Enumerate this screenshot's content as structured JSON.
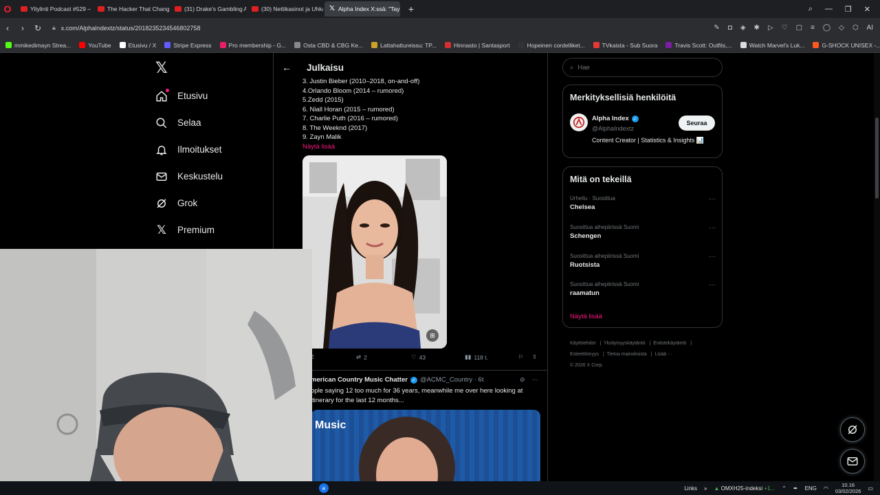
{
  "browser": {
    "tabs": [
      {
        "label": "Yliylinti Podcast #529 – U",
        "active": false
      },
      {
        "label": "The Hacker That Changed",
        "active": false
      },
      {
        "label": "(31) Drake's Gambling Ad",
        "active": false
      },
      {
        "label": "(30) Nettikasinot ja Uhkap",
        "active": false
      },
      {
        "label": "Alpha Index X:ssä: \"Taylor",
        "active": true
      }
    ],
    "url": "x.com/AlphaIndextz/status/2018235234546802758",
    "bookmarks": [
      {
        "label": "mmikedimayn Strea...",
        "color": "#53fc18"
      },
      {
        "label": "YouTube",
        "color": "#ff0000"
      },
      {
        "label": "Etusivu / X",
        "color": "#ffffff"
      },
      {
        "label": "Stripe Express",
        "color": "#635bff"
      },
      {
        "label": "Pro membership - G...",
        "color": "#e91e63"
      },
      {
        "label": "Osta CBD & CBG Ke...",
        "color": "#888888"
      },
      {
        "label": "Lattahattureissu: TP...",
        "color": "#c9a227"
      },
      {
        "label": "Hinnasto | Santasport",
        "color": "#d32f2f"
      },
      {
        "label": "Hopeinen cordelliket...",
        "color": "#333333"
      },
      {
        "label": "TVkaista - Sub Suora",
        "color": "#e53935"
      },
      {
        "label": "Travis Scott: Outfits,...",
        "color": "#7b1fa2"
      },
      {
        "label": "Watch Marvel's Luk...",
        "color": "#dddddd"
      },
      {
        "label": "G-SHOCK UNISEX -...",
        "color": "#ff5722"
      }
    ]
  },
  "x": {
    "nav": [
      {
        "label": "Etusivu",
        "icon": "home-icon",
        "badge": true
      },
      {
        "label": "Selaa",
        "icon": "search-icon",
        "badge": false
      },
      {
        "label": "Ilmoitukset",
        "icon": "bell-icon",
        "badge": false
      },
      {
        "label": "Keskustelu",
        "icon": "mail-icon",
        "badge": false
      },
      {
        "label": "Grok",
        "icon": "grok-icon",
        "badge": false
      },
      {
        "label": "Premium",
        "icon": "x-premium-icon",
        "badge": false
      }
    ],
    "header_title": "Julkaisu",
    "post_list": [
      "3. Justin Bieber (2010–2018, on-and-off)",
      "4.Orlando Bloom (2014 – rumored)",
      "5.Zedd (2015)",
      "6. Niall Horan (2015 – rumored)",
      "7. Charlie Puth (2016 – rumored)",
      "8. The Weeknd (2017)",
      "9. Zayn Malik"
    ],
    "show_more": "Näytä lisää",
    "post_stats": {
      "replies": "2",
      "reposts": "2",
      "likes": "43",
      "views": "118 t."
    },
    "tweet2": {
      "name": "merican Country Music Chatter",
      "handle": "@ACMC_Country · 6t",
      "text": "ople saying 12 too much for 36 years, meanwhile me over here looking at\n itinerary for the last 12 months...",
      "media_label": "Music"
    },
    "search_placeholder": "Hae",
    "relevant": {
      "title": "Merkityksellisiä henkilöitä",
      "name": "Alpha Index",
      "handle": "@AlphaIndextz",
      "follow": "Seuraa",
      "bio": "Content Creator | Statistics & Insights 📊"
    },
    "trends": {
      "title": "Mitä on tekeillä",
      "items": [
        {
          "meta": "Urheilu · Suosittua",
          "name": "Chelsea"
        },
        {
          "meta": "Suosittua aihepiirissä Suomi",
          "name": "Schengen"
        },
        {
          "meta": "Suosittua aihepiirissä Suomi",
          "name": "Ruotsista"
        },
        {
          "meta": "Suosittua aihepiirissä Suomi",
          "name": "raamatun"
        }
      ],
      "more": "Näytä lisää"
    },
    "footer": {
      "links": [
        "Käyttöehdot",
        "Yksityisyyskäytäntö",
        "Evästekäytäntö",
        "Esteettömyys",
        "Tietoa mainoksista",
        "Lisää ···"
      ],
      "copyright": "© 2026 X Corp."
    }
  },
  "taskbar": {
    "links": "Links",
    "stock_name": "OMXH25-indeksi",
    "stock_change": "+1...",
    "lang": "ENG",
    "time": "10.16",
    "date": "03/02/2026"
  }
}
